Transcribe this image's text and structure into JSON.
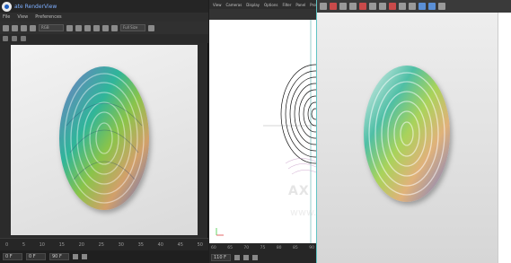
{
  "left_panel": {
    "window_title": "ate RenderView",
    "menu": [
      "File",
      "View",
      "Preferences"
    ],
    "toolbar_select": "RGB",
    "toolbar_select2": "Full Size",
    "timeline_ticks": [
      "0",
      "5",
      "10",
      "15",
      "20",
      "25",
      "30",
      "35",
      "40",
      "45",
      "50"
    ],
    "frame_field": "0 F",
    "frame_field2": "0 F",
    "end_field": "90 F"
  },
  "middle_panel": {
    "menu": [
      "View",
      "Cameras",
      "Display",
      "Options",
      "Filter",
      "Panel",
      "ProRender"
    ],
    "ticks": [
      "60",
      "65",
      "70",
      "75",
      "80",
      "85",
      "90"
    ],
    "status_value": "110 F",
    "watermark": "AX",
    "watermark2": "www.cgbbs.com"
  },
  "right_panel": {
    "toolbar_icons": [
      "render-icon",
      "stop-icon",
      "save-icon",
      "copy-icon",
      "gear-icon",
      "histogram-icon",
      "snapshot-icon",
      "compare-icon",
      "zoom-in-icon",
      "zoom-out-icon",
      "fit-icon",
      "grid-icon",
      "eye-icon"
    ]
  },
  "colors": {
    "accent": "#7fb0ff",
    "divider": "#5fc4c4",
    "panel_bg": "#2b2b2b",
    "render_bg": "#e6e6e6"
  }
}
